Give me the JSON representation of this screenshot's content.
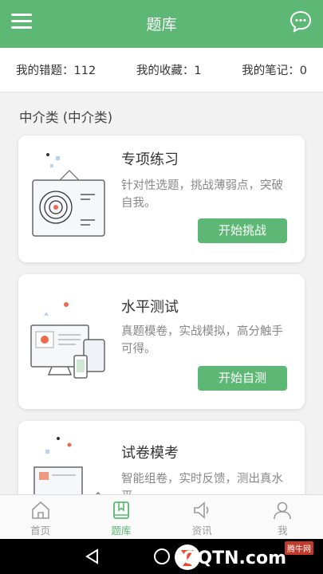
{
  "appbar": {
    "title": "题库",
    "menu_icon": "menu-icon",
    "chat_icon": "chat-bubble-icon"
  },
  "stats": {
    "wrong": "我的错题：112",
    "favorites": "我的收藏：1",
    "notes": "我的笔记：0"
  },
  "section": {
    "title": "中介类 (中介类)"
  },
  "cards": [
    {
      "title": "专项练习",
      "desc": "针对性选题，挑战薄弱点，突破自我。",
      "button": "开始挑战"
    },
    {
      "title": "水平测试",
      "desc": "真题模卷，实战模拟，高分触手可得。",
      "button": "开始自测"
    },
    {
      "title": "试卷模考",
      "desc": "智能组卷，实时反馈，测出真水平。"
    }
  ],
  "tabs": [
    {
      "label": "首页",
      "icon": "home-icon"
    },
    {
      "label": "题库",
      "icon": "book-icon",
      "active": true
    },
    {
      "label": "资讯",
      "icon": "speaker-icon"
    },
    {
      "label": "我",
      "icon": "user-icon"
    }
  ],
  "watermark": {
    "text": "QQTN.com",
    "badge": "腾牛网"
  },
  "colors": {
    "accent": "#5cb874",
    "background": "#f2f2f2"
  }
}
